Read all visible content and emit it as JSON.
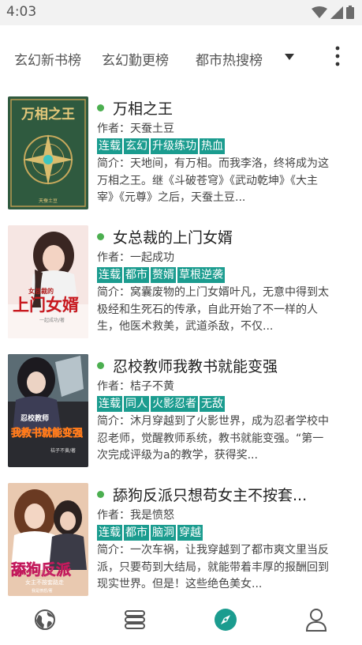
{
  "status_bar": {
    "time": "4:03"
  },
  "tabs": [
    "玄幻新书榜",
    "玄幻勤更榜",
    "都市热搜榜"
  ],
  "books": [
    {
      "title": "万相之王",
      "author": "作者：天蚕土豆",
      "tags": [
        "连载",
        "玄幻",
        "升级练功",
        "热血"
      ],
      "description": "简介：天地间，有万相。而我李洛，终将成为这万相之王。继《斗破苍穹》《武动乾坤》《大主宰》《元尊》之后，天蚕土豆...",
      "cover_text": "万相之王",
      "cover_author": "天蚕土豆"
    },
    {
      "title": "女总裁的上门女婿",
      "author": "作者：一起成功",
      "tags": [
        "连载",
        "都市",
        "赘婿",
        "草根逆袭"
      ],
      "description": "简介：窝囊废物的上门女婿叶凡，无意中得到太极经和生死石的传承，自此开始了不一样的人生，他医术救美，武道杀敌，不仅...",
      "cover_text": "上门女婿",
      "cover_subtext": "女总裁的",
      "cover_author": "一起成功/著"
    },
    {
      "title": "忍校教师我教书就能变强",
      "author": "作者：桔子不黄",
      "tags": [
        "连载",
        "同人",
        "火影忍者",
        "无敌"
      ],
      "description": "简介：沐月穿越到了火影世界，成为忍者学校中忍老师，觉醒教师系统，教书就能变强。“第一次完成评级为a的教学，获得奖...",
      "cover_text": "我教书就能变强",
      "cover_subtext": "忍校教师",
      "cover_author": "桔子不黄/著"
    },
    {
      "title": "舔狗反派只想苟女主不按套...",
      "author": "作者：我是愤怒",
      "tags": [
        "连载",
        "都市",
        "脑洞",
        "穿越"
      ],
      "description": "简介：一次车祸，让我穿越到了都市爽文里当反派，只要苟到大结局，就能带着丰厚的报酬回到现实世界。但是！这些绝色美女...",
      "cover_text": "舔狗反派",
      "cover_subtext": "女主不按套路走",
      "cover_author": "我是愤怒/著"
    }
  ],
  "nav": [
    {
      "icon": "globe-icon"
    },
    {
      "icon": "bookshelf-icon"
    },
    {
      "icon": "compass-icon",
      "active": true
    },
    {
      "icon": "person-icon"
    }
  ],
  "colors": {
    "tag": "#1b9c8f",
    "accent": "#1b9c8f",
    "dot": "#4caf50"
  }
}
